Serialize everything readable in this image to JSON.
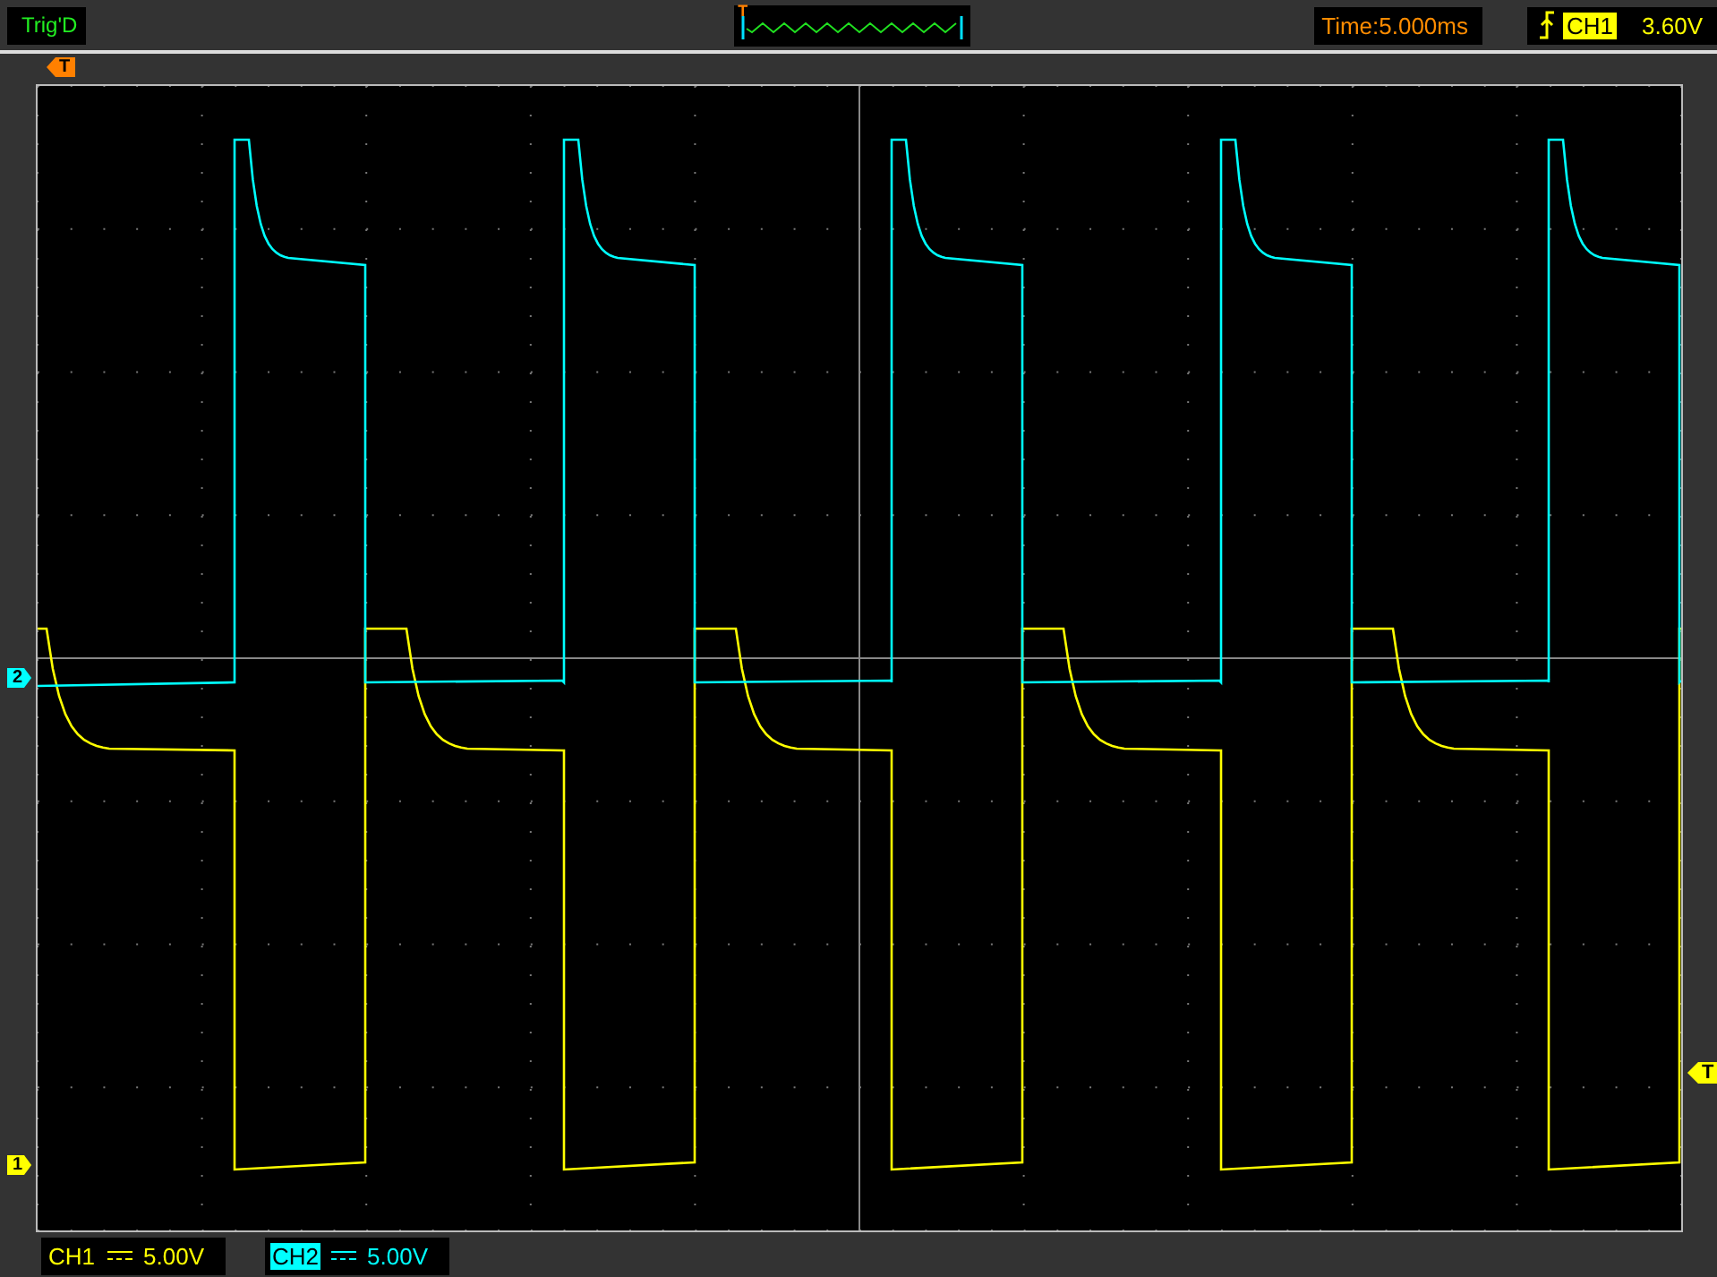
{
  "status_bar": {
    "trigger_state": "Trig'D",
    "overview_marker": "T",
    "timebase": "Time:5.000ms",
    "trigger": {
      "source": "CH1",
      "level": "3.60V"
    }
  },
  "trigger_position_marker": "T",
  "trigger_level_marker": "T",
  "channel_markers": [
    {
      "label": "2",
      "color": "#00ffff"
    },
    {
      "label": "1",
      "color": "#ffff00"
    }
  ],
  "channels": [
    {
      "label": "CH1",
      "scale": "5.00V",
      "color": "#ffff00",
      "selected": false
    },
    {
      "label": "CH2",
      "scale": "5.00V",
      "color": "#00ffff",
      "selected": true
    }
  ]
}
